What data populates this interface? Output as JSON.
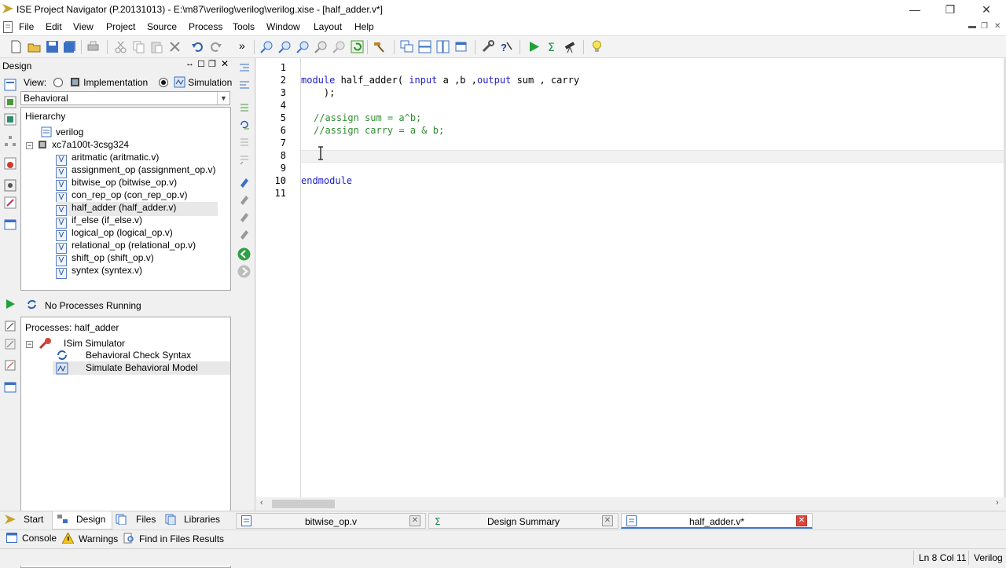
{
  "window": {
    "title": "ISE Project Navigator (P.20131013) - E:\\m87\\verilog\\verilog\\verilog.xise - [half_adder.v*]",
    "minimize": "—",
    "restore": "❐",
    "close": "✕"
  },
  "menu": [
    "File",
    "Edit",
    "View",
    "Project",
    "Source",
    "Process",
    "Tools",
    "Window",
    "Layout",
    "Help"
  ],
  "design_panel": {
    "header": "Design",
    "view_label": "View:",
    "implementation_label": "Implementation",
    "simulation_label": "Simulation",
    "selected_view": "Simulation",
    "filter_value": "Behavioral",
    "hierarchy_label": "Hierarchy",
    "project": "verilog",
    "device": "xc7a100t-3csg324",
    "files": [
      "aritmatic (aritmatic.v)",
      "assignment_op (assignment_op.v)",
      "bitwise_op (bitwise_op.v)",
      "con_rep_op (con_rep_op.v)",
      "half_adder (half_adder.v)",
      "if_else (if_else.v)",
      "logical_op (logical_op.v)",
      "relational_op (relational_op.v)",
      "shift_op (shift_op.v)",
      "syntex (syntex.v)"
    ],
    "selected_file_index": 4
  },
  "process_panel": {
    "status": "No Processes Running",
    "header": "Processes: half_adder",
    "tool": "ISim Simulator",
    "items": [
      "Behavioral Check Syntax",
      "Simulate Behavioral Model"
    ]
  },
  "editor": {
    "line_numbers": [
      "1",
      "2",
      "3",
      "4",
      "5",
      "6",
      "7",
      "8",
      "9",
      "10",
      "11"
    ],
    "line2_kw1": "module",
    "line2_a": " half_adder( ",
    "line2_kw2": "input",
    "line2_b": " a ,b ,",
    "line2_kw3": "output",
    "line2_c": " sum , carry",
    "line3": "    );",
    "line5": "//assign sum = a^b;",
    "line6": "//assign carry = a & b;",
    "line10": "endmodule"
  },
  "bottom_tabs": [
    "Start",
    "Design",
    "Files",
    "Libraries"
  ],
  "doc_tabs": [
    "bitwise_op.v",
    "Design Summary",
    "half_adder.v*"
  ],
  "console_tabs": [
    "Console",
    "Warnings",
    "Find in Files Results"
  ],
  "status": {
    "position": "Ln 8 Col 11",
    "language": "Verilog"
  },
  "colors": {
    "keyword": "#1c1cc8",
    "comment": "#2f8c2f",
    "active_tab_close": "#d9473f"
  }
}
